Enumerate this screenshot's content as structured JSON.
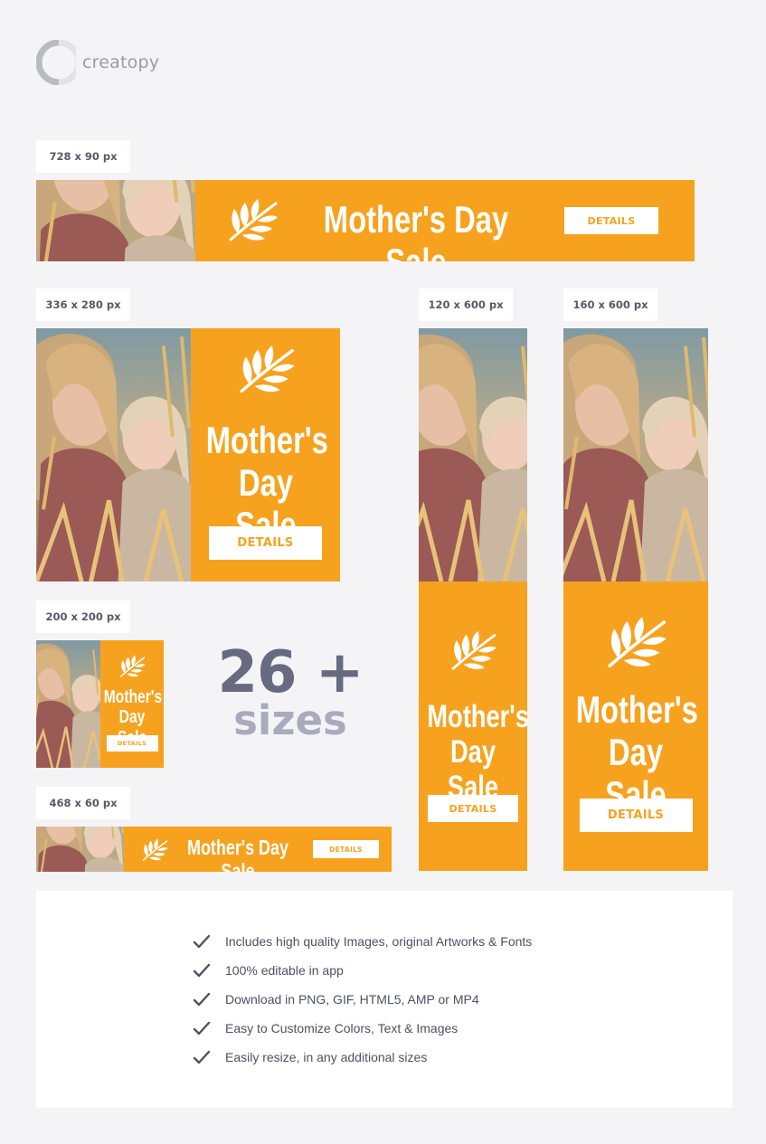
{
  "brand": {
    "name": "creatopy",
    "accent": "#f7a21e",
    "logo_icon": "creatopy-logo-icon"
  },
  "banner_content": {
    "headline": "Mother's Day Sale",
    "headline_stacked": "Mother's\nDay Sale",
    "button_label": "DETAILS",
    "leaf_icon": "wheat-leaf-icon"
  },
  "sizes": {
    "s728x90": "728 x 90 px",
    "s336x280": "336 x 280 px",
    "s120x600": "120 x 600 px",
    "s160x600": "160 x 600 px",
    "s200x200": "200 x 200 px",
    "s468x60": "468 x 60 px"
  },
  "promo": {
    "count": "26 +",
    "word": "sizes"
  },
  "features": [
    "Includes high quality Images, original Artworks & Fonts",
    "100% editable in app",
    "Download in PNG, GIF, HTML5, AMP or MP4",
    "Easy to Customize Colors, Text & Images",
    "Easily resize, in any additional sizes"
  ],
  "colors": {
    "background": "#f4f4f7",
    "tag_text": "#565a66",
    "count_dark": "#676a80",
    "count_light": "#a9abbc"
  }
}
